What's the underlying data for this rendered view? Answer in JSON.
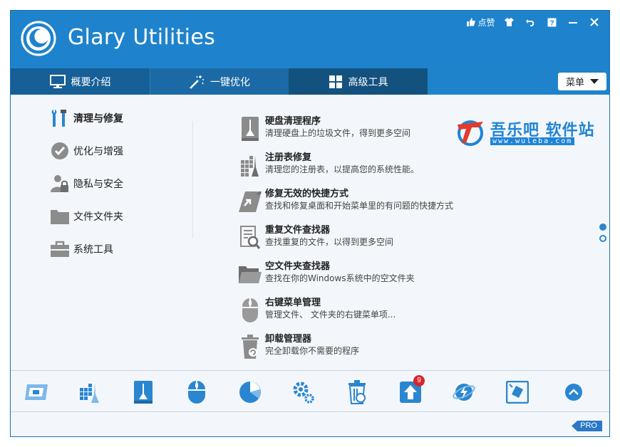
{
  "window": {
    "title": "Glary Utilities",
    "like_label": "点赞"
  },
  "nav": {
    "tabs": [
      {
        "label": "概要介绍",
        "icon": "monitor-icon"
      },
      {
        "label": "一键优化",
        "icon": "magic-wand-icon"
      },
      {
        "label": "高级工具",
        "icon": "grid-icon",
        "active": true
      }
    ],
    "menu_label": "菜单"
  },
  "categories": [
    {
      "label": "清理与修复",
      "icon": "wrench-screwdriver-icon",
      "active": true
    },
    {
      "label": "优化与增强",
      "icon": "check-badge-icon"
    },
    {
      "label": "隐私与安全",
      "icon": "user-lock-icon"
    },
    {
      "label": "文件文件夹",
      "icon": "folder-icon"
    },
    {
      "label": "系统工具",
      "icon": "toolbox-icon"
    }
  ],
  "tools": [
    {
      "name": "硬盘清理程序",
      "desc": "清理硬盘上的垃圾文件，得到更多空间",
      "icon": "disk-cleaner-icon"
    },
    {
      "name": "注册表修复",
      "desc": "清理您的注册表，以提高您的系统性能。",
      "icon": "registry-broom-icon"
    },
    {
      "name": "修复无效的快捷方式",
      "desc": "查找和修复桌面和开始菜单里的有问题的快捷方式",
      "icon": "shortcut-fix-icon"
    },
    {
      "name": "重复文件查找器",
      "desc": "查找重复的文件，以得到更多空间",
      "icon": "duplicate-finder-icon"
    },
    {
      "name": "空文件夹查找器",
      "desc": "查找在你的Windows系统中的空文件夹",
      "icon": "empty-folder-icon"
    },
    {
      "name": "右键菜单管理",
      "desc": "管理文件、 文件夹的右键菜单项...",
      "icon": "mouse-icon"
    },
    {
      "name": "卸载管理器",
      "desc": "完全卸载你不需要的程序",
      "icon": "uninstall-trash-icon"
    }
  ],
  "watermark": {
    "title": "吾乐吧 软件站",
    "url": "www.wuleba.com"
  },
  "bottom_toolbar": {
    "update_badge": "9"
  },
  "status": {
    "pro_label": "PRO"
  },
  "colors": {
    "titlebar": "#1e83cc",
    "accent": "#2a86d0",
    "badge": "#d8262d"
  }
}
